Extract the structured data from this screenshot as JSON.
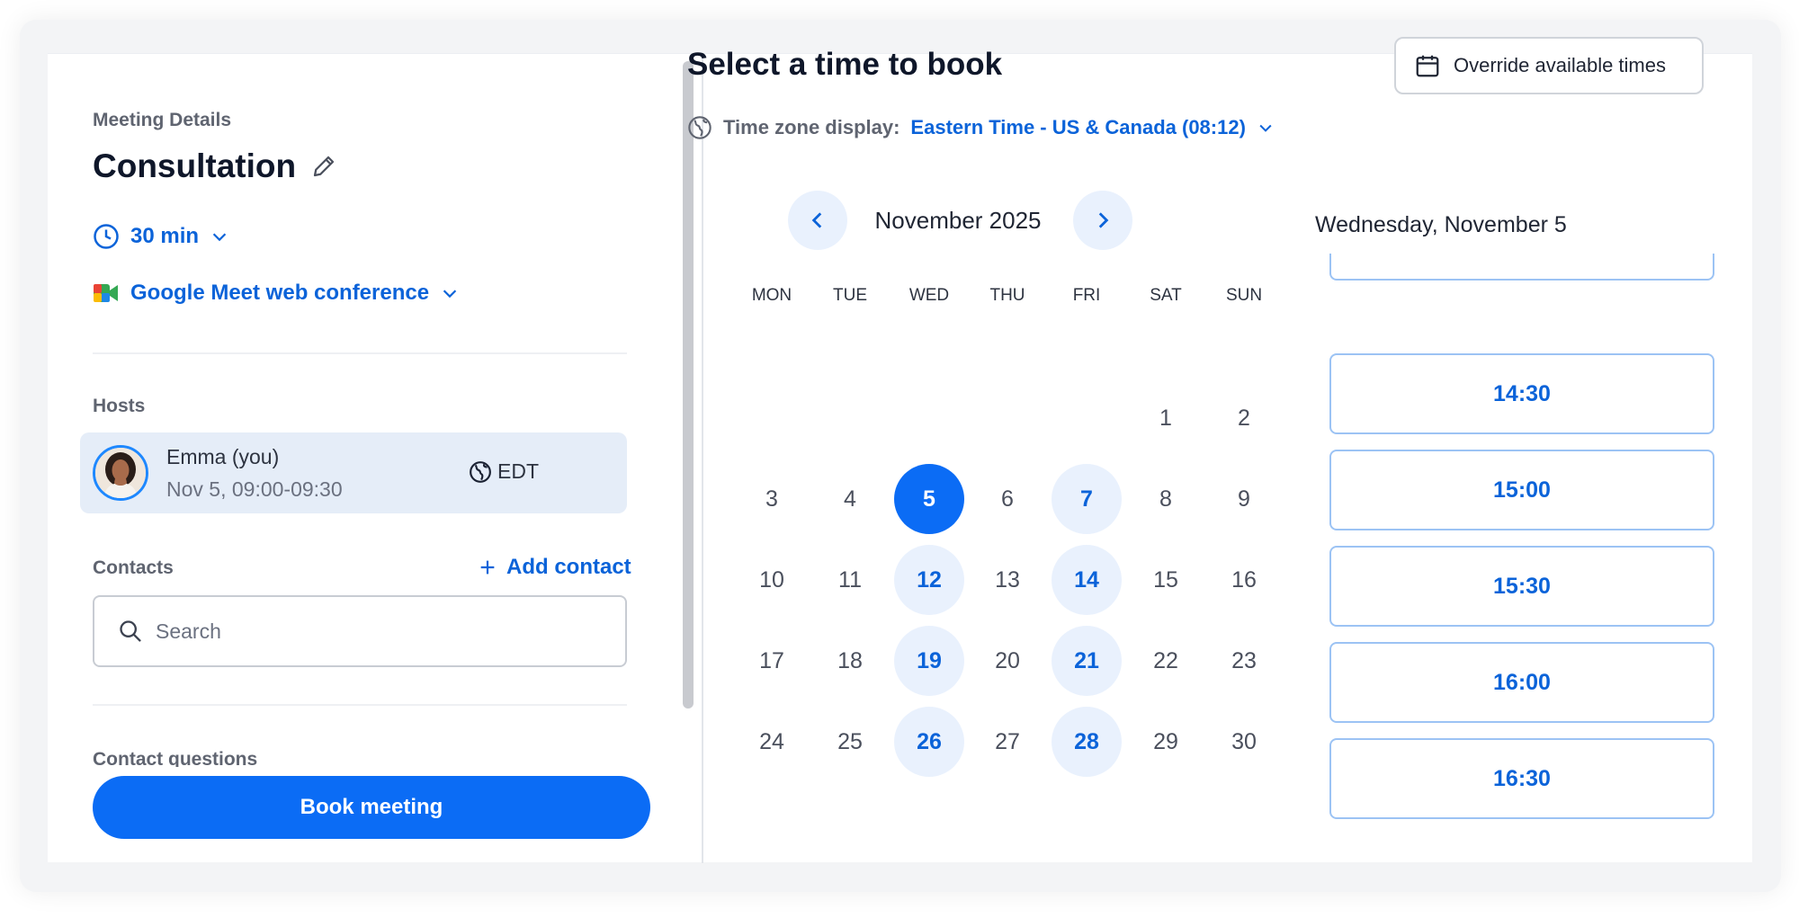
{
  "meeting": {
    "section_label": "Meeting Details",
    "title": "Consultation",
    "duration": "30 min",
    "conference": "Google Meet web conference"
  },
  "hosts": {
    "label": "Hosts",
    "items": [
      {
        "name": "Emma (you)",
        "time": "Nov 5, 09:00-09:30",
        "timezone": "EDT"
      }
    ]
  },
  "contacts": {
    "label": "Contacts",
    "add_label": "Add contact",
    "search_placeholder": "Search"
  },
  "contact_questions": {
    "label": "Contact questions"
  },
  "book_button": "Book meeting",
  "booking": {
    "title": "Select a time to book",
    "override_label": "Override available times",
    "timezone_label": "Time zone display:",
    "timezone_value": "Eastern Time - US & Canada (08:12)"
  },
  "calendar": {
    "month": "November 2025",
    "weekdays": [
      "MON",
      "TUE",
      "WED",
      "THU",
      "FRI",
      "SAT",
      "SUN"
    ],
    "weeks": [
      [
        "",
        "",
        "",
        "",
        "",
        "1",
        "2"
      ],
      [
        "3",
        "4",
        "5",
        "6",
        "7",
        "8",
        "9"
      ],
      [
        "10",
        "11",
        "12",
        "13",
        "14",
        "15",
        "16"
      ],
      [
        "17",
        "18",
        "19",
        "20",
        "21",
        "22",
        "23"
      ],
      [
        "24",
        "25",
        "26",
        "27",
        "28",
        "29",
        "30"
      ]
    ],
    "available_days": [
      "5",
      "7",
      "12",
      "14",
      "19",
      "21",
      "26",
      "28"
    ],
    "selected_day": "5"
  },
  "slots": {
    "date_heading": "Wednesday, November 5",
    "times": [
      "14:30",
      "15:00",
      "15:30",
      "16:00",
      "16:30"
    ]
  },
  "colors": {
    "accent": "#0b6cf5",
    "link": "#0b63d9",
    "available_bg": "#e9f1fd",
    "host_card_bg": "#e5edf8"
  }
}
